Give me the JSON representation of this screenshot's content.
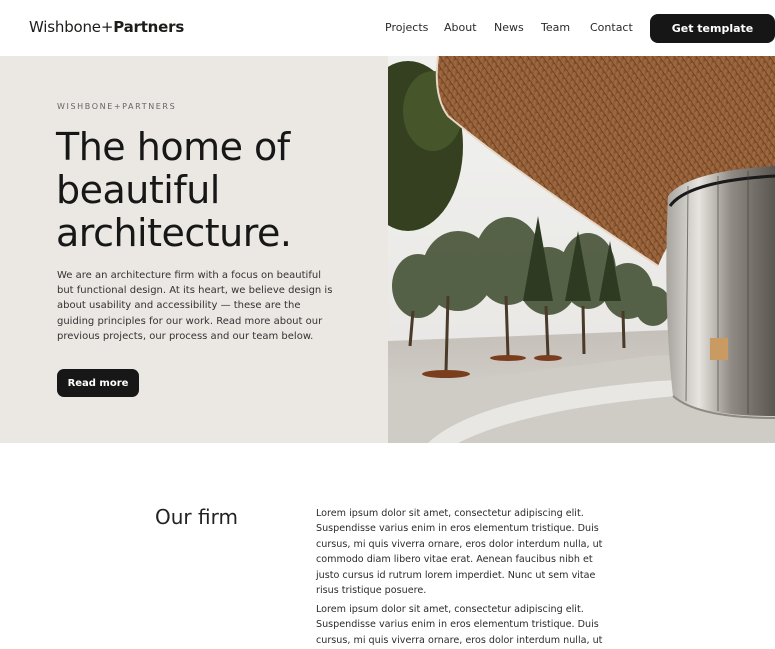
{
  "nav": {
    "brand_light": "Wishbone+",
    "brand_bold": "Partners",
    "links": [
      "Projects",
      "About",
      "News",
      "Team",
      "Contact"
    ],
    "cta_label": "Get template"
  },
  "hero": {
    "eyebrow": "WISHBONE+PARTNERS",
    "headline": [
      "The home of",
      "beautiful",
      "architecture."
    ],
    "intro": [
      "We are an architecture firm with a focus on beautiful",
      "but functional design. At its heart, we believe design is",
      "about usability and accessibility — these are the",
      "guiding principles for our work. Read more about our",
      "previous projects, our process and our team below."
    ],
    "button_label": "Read more"
  },
  "firm": {
    "title": "Our firm",
    "paragraph1": [
      "Lorem ipsum dolor sit amet, consectetur adipiscing elit.",
      "Suspendisse varius enim in eros elementum tristique. Duis",
      "cursus, mi quis viverra ornare, eros dolor interdum nulla, ut",
      "commodo diam libero vitae erat. Aenean faucibus nibh et",
      "justo cursus id rutrum lorem imperdiet. Nunc ut sem vitae",
      "risus tristique posuere."
    ],
    "paragraph2": [
      "Lorem ipsum dolor sit amet, consectetur adipiscing elit.",
      "Suspendisse varius enim in eros elementum tristique. Duis",
      "cursus, mi quis viverra ornare, eros dolor interdum nulla, ut"
    ]
  },
  "colors": {
    "hero_background": "#ebe7e3",
    "button_dark": "#161616",
    "text_dark": "#1d1d1b"
  }
}
